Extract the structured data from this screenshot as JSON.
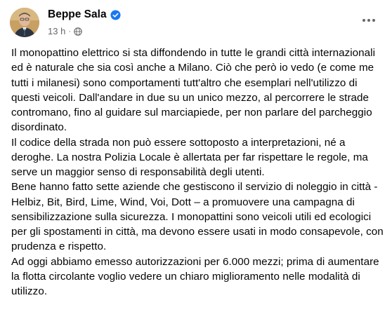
{
  "post": {
    "author": "Beppe Sala",
    "verified_icon": "verified-badge-icon",
    "timestamp": "13 h",
    "separator": "·",
    "audience_icon": "globe-icon",
    "more_icon": "more-horizontal-icon",
    "paragraphs": [
      "Il monopattino elettrico si sta diffondendo in tutte le grandi città internazionali ed è naturale che sia così anche a Milano. Ciò che però io vedo (e come me tutti i milanesi) sono comportamenti tutt'altro che esemplari nell'utilizzo di questi veicoli. Dall'andare in due su un unico mezzo, al percorrere le strade contromano, fino al guidare sul marciapiede, per non parlare del parcheggio disordinato.",
      "Il codice della strada non può essere sottoposto a interpretazioni, né a deroghe. La nostra Polizia Locale è allertata per far rispettare le regole, ma serve un maggior senso di responsabilità degli utenti.",
      "Bene hanno fatto sette aziende che gestiscono il servizio di noleggio in città - Helbiz, Bit, Bird, Lime, Wind, Voi, Dott – a promuovere una campagna di sensibilizzazione sulla sicurezza. I monopattini sono veicoli utili ed ecologici per gli spostamenti in città, ma devono essere usati in modo consapevole, con prudenza e rispetto.",
      "Ad oggi abbiamo emesso autorizzazioni per 6.000 mezzi; prima di aumentare la flotta circolante voglio vedere un chiaro miglioramento nelle modalità di utilizzo."
    ]
  },
  "colors": {
    "text": "#050505",
    "secondary": "#65676b",
    "verified": "#1877f2",
    "background": "#ffffff"
  }
}
